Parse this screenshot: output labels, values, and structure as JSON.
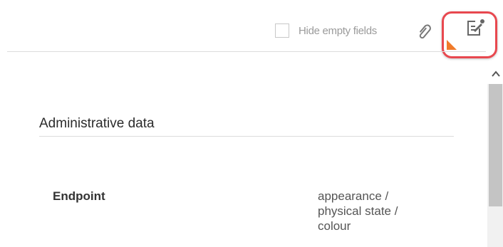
{
  "toolbar": {
    "hide_empty_label": "Hide empty fields",
    "hide_empty_checked": false
  },
  "icons": {
    "attachment": "paperclip-icon",
    "notes": "edit-note-icon",
    "scroll_up": "chevron-up-icon"
  },
  "colors": {
    "annotation_border": "#e8484f",
    "flag": "#f07a2a"
  },
  "section": {
    "title": "Administrative data"
  },
  "field": {
    "label": "Endpoint",
    "value_lines": [
      "appearance /",
      "physical state /",
      "colour"
    ]
  }
}
